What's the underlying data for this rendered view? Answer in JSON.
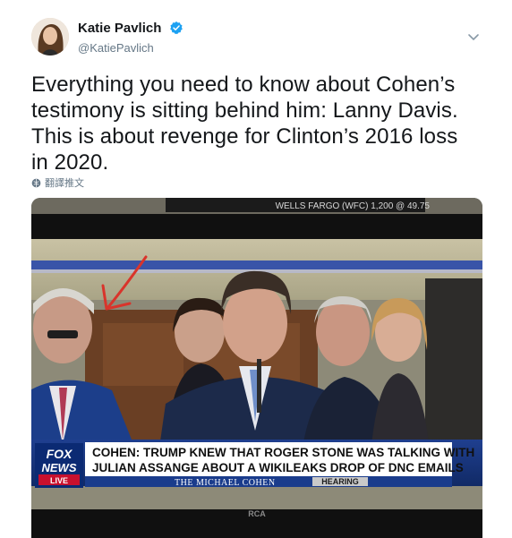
{
  "author": {
    "name": "Katie Pavlich",
    "handle": "@KatiePavlich"
  },
  "tweet": {
    "lines": [
      "Everything you need to know about Cohen’s",
      "testimony is sitting behind him: Lanny Davis.",
      "This is about revenge for Clinton’s 2016 loss",
      "in 2020."
    ],
    "translate_label": "翻譯推文"
  },
  "media": {
    "ticker": "WELLS FARGO (WFC) 1,200 @ 49.75",
    "chyron_line1": "COHEN: TRUMP KNEW THAT ROGER STONE WAS TALKING WITH",
    "chyron_line2": "JULIAN ASSANGE ABOUT A WIKILEAKS DROP OF DNC EMAILS",
    "chyron_sub": "THE MICHAEL COHEN",
    "chyron_tag": "HEARING",
    "logo_top": "FOX",
    "logo_mid": "NEWS",
    "logo_live": "LIVE",
    "tv_brand": "RCA"
  },
  "icons": {
    "verified": "verified-badge-icon",
    "more": "chevron-down-icon",
    "translate": "globe-icon"
  },
  "colors": {
    "verified_blue": "#1da1f2",
    "text": "#14171a",
    "muted": "#657786",
    "arrow_red": "#d9342b"
  }
}
